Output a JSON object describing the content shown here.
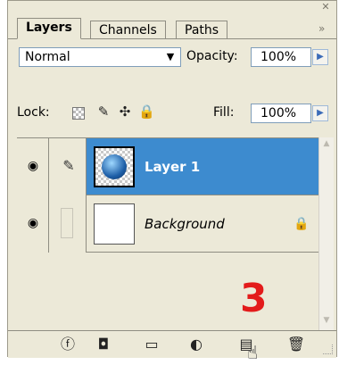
{
  "tabs": [
    "Layers",
    "Channels",
    "Paths"
  ],
  "blend_mode": "Normal",
  "opacity_label": "Opacity:",
  "opacity_value": "100%",
  "lock_label": "Lock:",
  "fill_label": "Fill:",
  "fill_value": "100%",
  "layers": [
    {
      "name": "Layer 1",
      "selected": true,
      "visible": true
    },
    {
      "name": "Background",
      "selected": false,
      "visible": true,
      "locked": true
    }
  ],
  "annotation_number": "3",
  "icons": {
    "close": "close-icon",
    "panel_menu": "double-chevron-icon",
    "blend_dropdown": "chevron-down-icon",
    "stepper": "arrow-right-icon",
    "lock_transparency": "checkerboard-icon",
    "lock_paint": "brush-icon",
    "lock_move": "move-icon",
    "lock_all": "padlock-icon",
    "link_styles": "link-icon",
    "add_mask": "mask-icon",
    "new_group": "folder-icon",
    "new_adjustment": "half-circle-icon",
    "new_layer": "new-page-icon",
    "delete": "trash-icon"
  },
  "colors": {
    "panel_bg": "#ece9d8",
    "selection": "#3d8bcf",
    "annotation": "#e31b1b"
  }
}
